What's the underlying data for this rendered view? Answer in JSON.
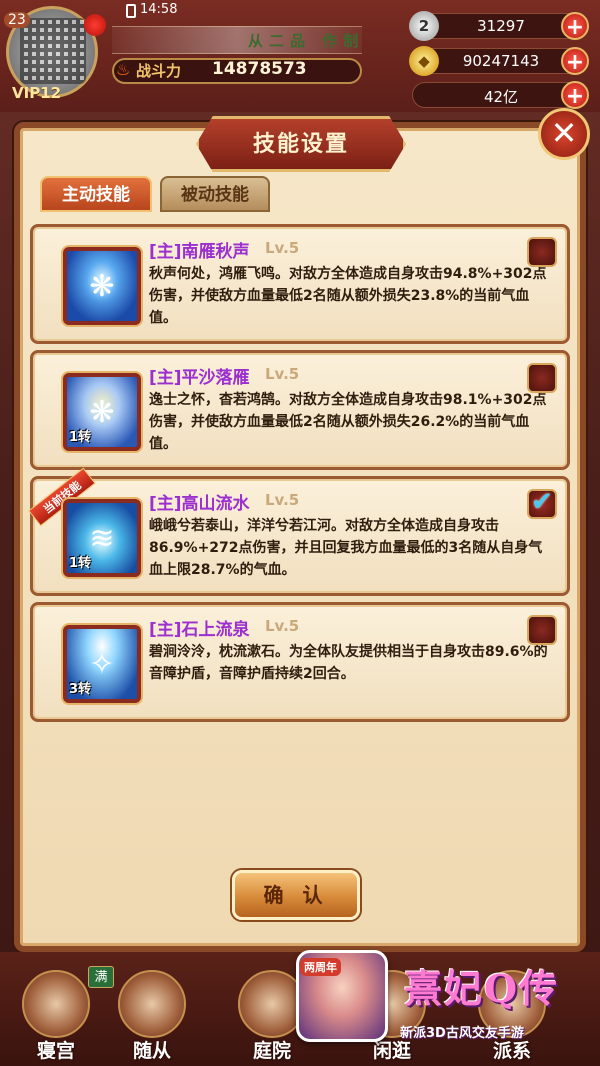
{
  "hud": {
    "time": "14:58",
    "level": "23",
    "vip": "VIP12",
    "rank_title": "从二品 作制",
    "power_label": "战斗力",
    "power_value": "14878573",
    "resources": [
      {
        "icon": "silver-coin-icon",
        "symbol": "2",
        "value": "31297"
      },
      {
        "icon": "gold-ingot-icon",
        "symbol": "◆",
        "value": "90247143"
      },
      {
        "icon": "money-icon",
        "symbol": "",
        "value": "42亿"
      }
    ]
  },
  "panel": {
    "title": "技能设置",
    "close_symbol": "✕",
    "tabs": [
      {
        "label": "主动技能",
        "active": true
      },
      {
        "label": "被动技能",
        "active": false
      }
    ],
    "current_ribbon": "当前技能",
    "skills": [
      {
        "name": "[主]南雁秋声",
        "level": "Lv.5",
        "rebirth": "",
        "desc": "秋声何处，鸿雁飞鸣。对敌方全体造成自身攻击94.8%+302点伤害，并使敌方血量最低2名随从额外损失23.8%的当前气血值。",
        "selected": false
      },
      {
        "name": "[主]平沙落雁",
        "level": "Lv.5",
        "rebirth": "1转",
        "desc": "逸士之怀，杳若鸿鹄。对敌方全体造成自身攻击98.1%+302点伤害，并使敌方血量最低2名随从额外损失26.2%的当前气血值。",
        "selected": false
      },
      {
        "name": "[主]高山流水",
        "level": "Lv.5",
        "rebirth": "1转",
        "desc": "峨峨兮若泰山，洋洋兮若江河。对敌方全体造成自身攻击86.9%+272点伤害，并且回复我方血量最低的3名随从自身气血上限28.7%的气血。",
        "selected": true
      },
      {
        "name": "[主]石上流泉",
        "level": "Lv.5",
        "rebirth": "3转",
        "desc": "碧涧泠泠，枕流漱石。为全体队友提供相当于自身攻击89.6%的音障护盾，音障护盾持续2回合。",
        "selected": false
      }
    ],
    "confirm_label": "确 认"
  },
  "bottom_nav": {
    "items": [
      "寝宫",
      "随从",
      "庭院",
      "闲逛",
      "派系"
    ],
    "badge": "满"
  },
  "ad": {
    "anniversary": "两周年",
    "logo": "熹妃Q传",
    "slogan": "新派3D古风交友手游"
  },
  "colors": {
    "accent_red": "#b3402b",
    "skill_name_purple": "#9b2fd0",
    "check_blue": "#4ac9ef"
  }
}
